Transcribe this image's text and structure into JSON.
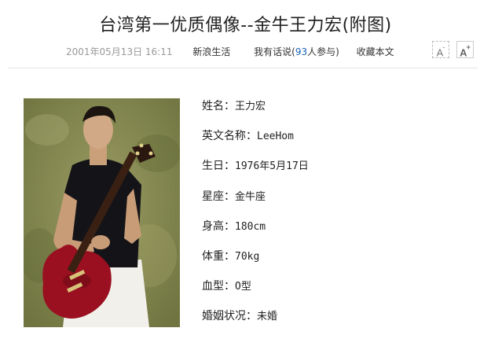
{
  "article": {
    "title": "台湾第一优质偶像--金牛王力宏(附图)",
    "date": "2001年05月13日  16:11",
    "channel": "新浪生活",
    "comment_prefix": "我有话说(",
    "comment_count": "93",
    "comment_suffix": "人参与)",
    "favorite": "收藏本文",
    "font_small": "A",
    "font_large": "A",
    "font_large_sup": "+",
    "font_small_sup": "-"
  },
  "profile": [
    {
      "label": "姓名：",
      "value": "王力宏"
    },
    {
      "label": "英文名称：",
      "value": "LeeHom"
    },
    {
      "label": "生日：",
      "value": "1976年5月17日"
    },
    {
      "label": "星座：",
      "value": "金牛座"
    },
    {
      "label": "身高：",
      "value": "180cm"
    },
    {
      "label": "体重：",
      "value": "70kg"
    },
    {
      "label": "血型：",
      "value": "O型"
    },
    {
      "label": "婚姻状况：",
      "value": "未婚"
    }
  ],
  "colors": {
    "link_count": "#1a64b8",
    "background_photo": "#8a8f55",
    "guitar": "#9a1020"
  }
}
